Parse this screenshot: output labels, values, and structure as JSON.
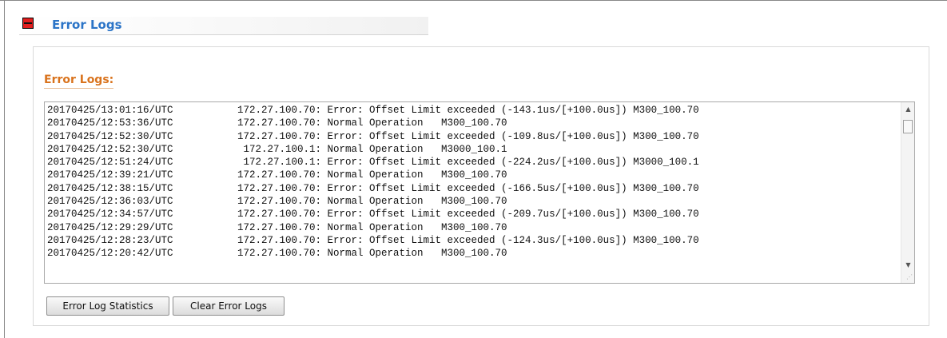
{
  "section": {
    "title": "Error Logs",
    "toggle_icon": "collapse-icon"
  },
  "panel": {
    "heading": "Error Logs:"
  },
  "log": {
    "lines": [
      {
        "timestamp": "20170425/13:01:16/UTC",
        "message": "172.27.100.70: Error: Offset Limit exceeded (-143.1us/[+100.0us]) M300_100.70"
      },
      {
        "timestamp": "20170425/12:53:36/UTC",
        "message": "172.27.100.70: Normal Operation   M300_100.70"
      },
      {
        "timestamp": "20170425/12:52:30/UTC",
        "message": "172.27.100.70: Error: Offset Limit exceeded (-109.8us/[+100.0us]) M300_100.70"
      },
      {
        "timestamp": "20170425/12:52:30/UTC",
        "message": " 172.27.100.1: Normal Operation   M3000_100.1"
      },
      {
        "timestamp": "20170425/12:51:24/UTC",
        "message": " 172.27.100.1: Error: Offset Limit exceeded (-224.2us/[+100.0us]) M3000_100.1"
      },
      {
        "timestamp": "20170425/12:39:21/UTC",
        "message": "172.27.100.70: Normal Operation   M300_100.70"
      },
      {
        "timestamp": "20170425/12:38:15/UTC",
        "message": "172.27.100.70: Error: Offset Limit exceeded (-166.5us/[+100.0us]) M300_100.70"
      },
      {
        "timestamp": "20170425/12:36:03/UTC",
        "message": "172.27.100.70: Normal Operation   M300_100.70"
      },
      {
        "timestamp": "20170425/12:34:57/UTC",
        "message": "172.27.100.70: Error: Offset Limit exceeded (-209.7us/[+100.0us]) M300_100.70"
      },
      {
        "timestamp": "20170425/12:29:29/UTC",
        "message": "172.27.100.70: Normal Operation   M300_100.70"
      },
      {
        "timestamp": "20170425/12:28:23/UTC",
        "message": "172.27.100.70: Error: Offset Limit exceeded (-124.3us/[+100.0us]) M300_100.70"
      },
      {
        "timestamp": "20170425/12:20:42/UTC",
        "message": "172.27.100.70: Normal Operation   M300_100.70"
      }
    ],
    "scroll_up_icon": "▲",
    "scroll_down_icon": "▼",
    "resize_icon": "⋰"
  },
  "buttons": {
    "statistics_label": "Error Log Statistics",
    "clear_label": "Clear Error Logs"
  },
  "colors": {
    "section_title": "#2b74c7",
    "panel_heading": "#d9731d",
    "toggle": "#e31e1e"
  }
}
